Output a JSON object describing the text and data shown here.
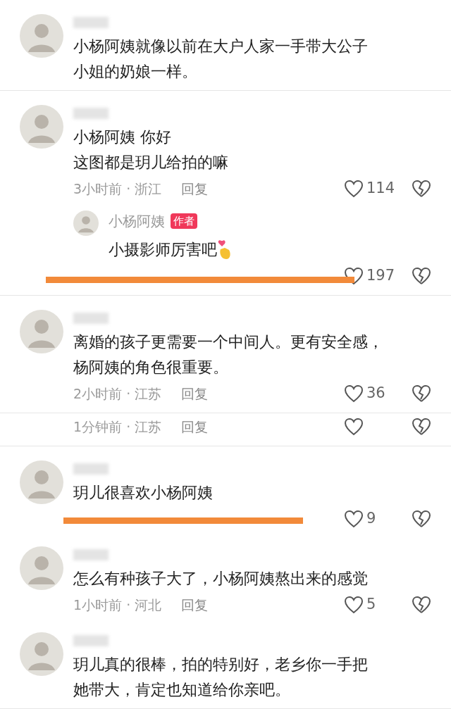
{
  "segments": [
    {
      "items": [
        {
          "kind": "comment",
          "lines": [
            "小杨阿姨就像以前在大户人家一手带大公子",
            "小姐的奶娘一样。"
          ]
        }
      ]
    },
    {
      "items": [
        {
          "kind": "comment",
          "lines": [
            "小杨阿姨 你好",
            "这图都是玥儿给拍的嘛"
          ],
          "time": "3小时前 · 浙江",
          "reply": "回复",
          "likes": "114"
        },
        {
          "kind": "reply",
          "name": "小杨阿姨",
          "badge": "作者",
          "lines": [
            "小摄影师厉害吧"
          ],
          "likes": "197",
          "struck": true
        }
      ]
    },
    {
      "items": [
        {
          "kind": "comment",
          "lines": [
            "离婚的孩子更需要一个中间人。更有安全感，",
            "杨阿姨的角色很重要。"
          ],
          "time": "2小时前 · 江苏",
          "reply": "回复",
          "likes": "36"
        }
      ]
    },
    {
      "items": [
        {
          "kind": "meta",
          "time": "1分钟前 · 江苏",
          "reply": "回复"
        }
      ]
    },
    {
      "items": [
        {
          "kind": "comment",
          "lines": [
            "玥儿很喜欢小杨阿姨"
          ],
          "likes": "9",
          "struck": true
        },
        {
          "kind": "comment",
          "lines": [
            "怎么有种孩子大了，小杨阿姨熬出来的感觉"
          ],
          "time": "1小时前 · 河北",
          "reply": "回复",
          "likes": "5"
        },
        {
          "kind": "comment",
          "lines": [
            "玥儿真的很棒，拍的特别好，老乡你一手把",
            "她带大，肯定也知道给你亲吧。"
          ]
        }
      ]
    }
  ]
}
